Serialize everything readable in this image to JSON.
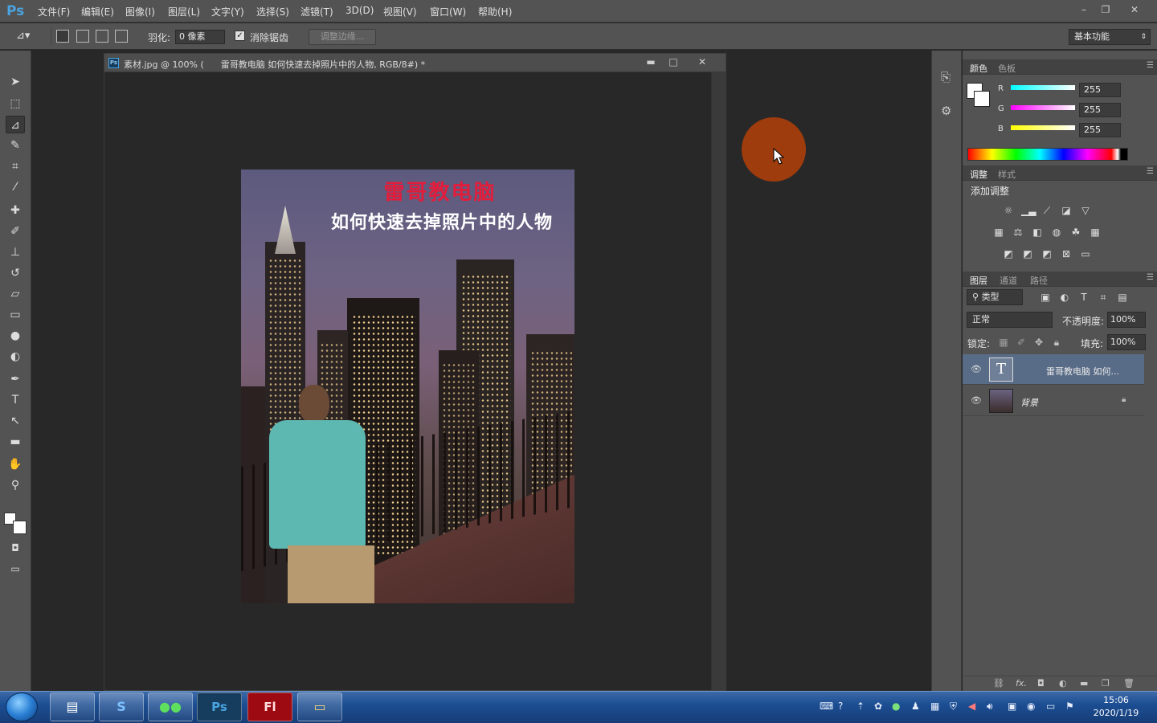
{
  "app": {
    "logo": "Ps",
    "menu": [
      "文件(F)",
      "编辑(E)",
      "图像(I)",
      "图层(L)",
      "文字(Y)",
      "选择(S)",
      "滤镜(T)",
      "3D(D)",
      "视图(V)",
      "窗口(W)",
      "帮助(H)"
    ],
    "window_controls": [
      "–",
      "❐",
      "✕"
    ]
  },
  "options": {
    "feather_label": "羽化:",
    "feather_value": "0 像素",
    "antialias_label": "消除锯齿",
    "antialias_checked": true,
    "refine_edge_label": "调整边缘...",
    "workspace": "基本功能"
  },
  "tools": [
    "move-icon",
    "marquee-icon",
    "polygonal-lasso-icon",
    "quick-selection-icon",
    "crop-icon",
    "eyedropper-icon",
    "healing-brush-icon",
    "brush-icon",
    "clone-stamp-icon",
    "history-brush-icon",
    "eraser-icon",
    "gradient-icon",
    "blur-icon",
    "dodge-icon",
    "pen-icon",
    "type-icon",
    "path-selection-icon",
    "rectangle-icon",
    "hand-icon",
    "zoom-icon"
  ],
  "document": {
    "title_prefix": "素材.jpg @ 100% (",
    "title_main": "雷哥教电脑 如何快速去掉照片中的人物, RGB/8#) *",
    "image_title1": "雷哥教电脑",
    "image_title2": "如何快速去掉照片中的人物"
  },
  "color_panel": {
    "tabs": [
      "颜色",
      "色板"
    ],
    "r_label": "R",
    "g_label": "G",
    "b_label": "B",
    "r": "255",
    "g": "255",
    "b": "255"
  },
  "adjust_panel": {
    "tabs": [
      "调整",
      "样式"
    ],
    "title": "添加调整"
  },
  "layers_panel": {
    "tabs": [
      "图层",
      "通道",
      "路径"
    ],
    "filter_kind": "类型",
    "blend_mode": "正常",
    "opacity_label": "不透明度:",
    "opacity": "100%",
    "lock_label": "锁定:",
    "fill_label": "填充:",
    "fill": "100%",
    "layers": [
      {
        "name": "雷哥教电脑 如何...",
        "type": "text",
        "selected": true
      },
      {
        "name": "背景",
        "type": "image",
        "locked": true
      }
    ]
  },
  "taskbar": {
    "apps": [
      "explorer",
      "sogou",
      "wechat",
      "Ps",
      "Fl",
      "folder"
    ],
    "time": "15:06",
    "date": "2020/1/19"
  },
  "colors": {
    "ui_gray": "#535353",
    "canvas_bg": "#282828",
    "cursor_highlight": "#9e3c0d",
    "title_red": "#e21d3c",
    "selected_layer": "#596c87"
  }
}
